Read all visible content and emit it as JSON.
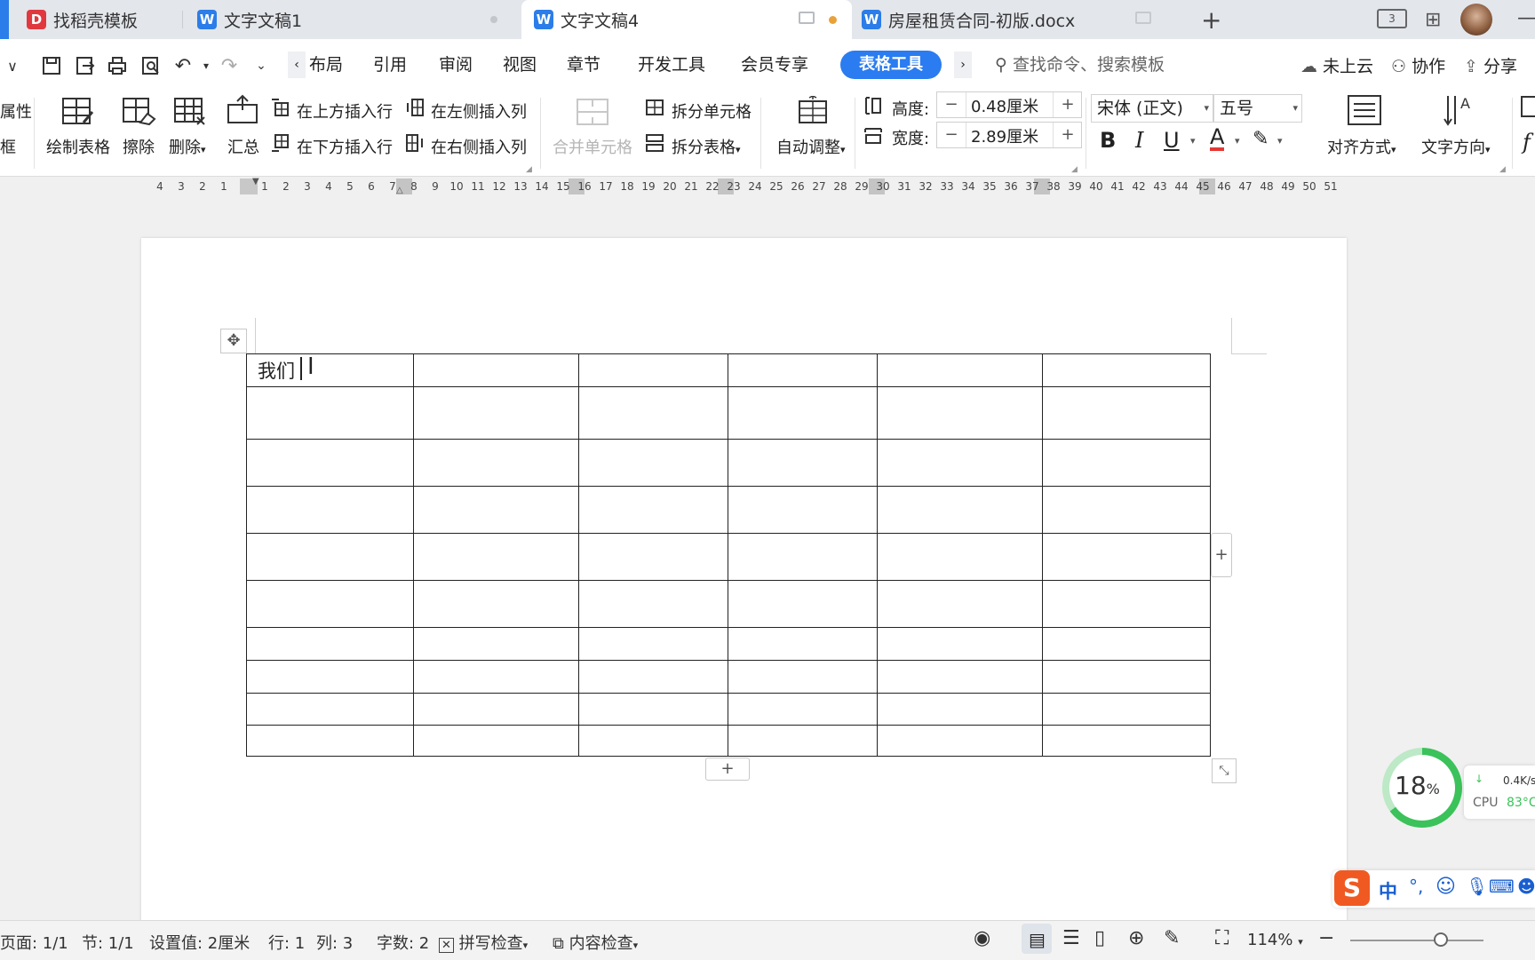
{
  "tabs": [
    {
      "label": "找稻壳模板"
    },
    {
      "label": "文字文稿1"
    },
    {
      "label": "文字文稿4"
    },
    {
      "label": "房屋租赁合同-初版.docx"
    }
  ],
  "menu": {
    "items": [
      "布局",
      "引用",
      "审阅",
      "视图",
      "章节",
      "开发工具",
      "会员专享"
    ],
    "table_tools": "表格工具",
    "search_placeholder": "查找命令、搜索模板",
    "cloud": "未上云",
    "collab": "协作",
    "share": "分享"
  },
  "ribbon": {
    "attr_partial": "属性",
    "frame_partial": "框",
    "draw_table": "绘制表格",
    "erase": "擦除",
    "delete": "删除",
    "summary": "汇总",
    "insert_row_above": "在上方插入行",
    "insert_row_below": "在下方插入行",
    "insert_col_left": "在左侧插入列",
    "insert_col_right": "在右侧插入列",
    "merge_cells": "合并单元格",
    "split_cells": "拆分单元格",
    "split_table": "拆分表格",
    "auto_fit": "自动调整",
    "height_label": "高度:",
    "height_value": "0.48厘米",
    "width_label": "宽度:",
    "width_value": "2.89厘米",
    "font_name": "宋体 (正文)",
    "font_size": "五号",
    "align": "对齐方式",
    "text_direction": "文字方向"
  },
  "document": {
    "cell_text": "我们"
  },
  "status": {
    "page": "页面: 1/1",
    "section": "节: 1/1",
    "setting": "设置值: 2厘米",
    "row": "行: 1",
    "col": "列: 3",
    "word_count": "字数: 2",
    "spell_check": "拼写检查",
    "content_check": "内容检查",
    "zoom": "114%"
  },
  "widget": {
    "percent": "18",
    "percent_sign": "%",
    "net": "0.4K/s",
    "cpu_label": "CPU",
    "cpu_temp": "83°C"
  },
  "ime": {
    "lang": "中"
  },
  "icons": [
    "save-icon",
    "export-icon",
    "print-icon",
    "preview-icon",
    "undo-icon",
    "redo-icon",
    "search-icon",
    "cloud-icon",
    "collab-icon",
    "share-icon",
    "bold-icon",
    "italic-icon",
    "underline-icon",
    "font-color-icon",
    "highlight-icon"
  ],
  "colors": {
    "accent": "#2a7cf0",
    "green": "#3bc25a"
  }
}
